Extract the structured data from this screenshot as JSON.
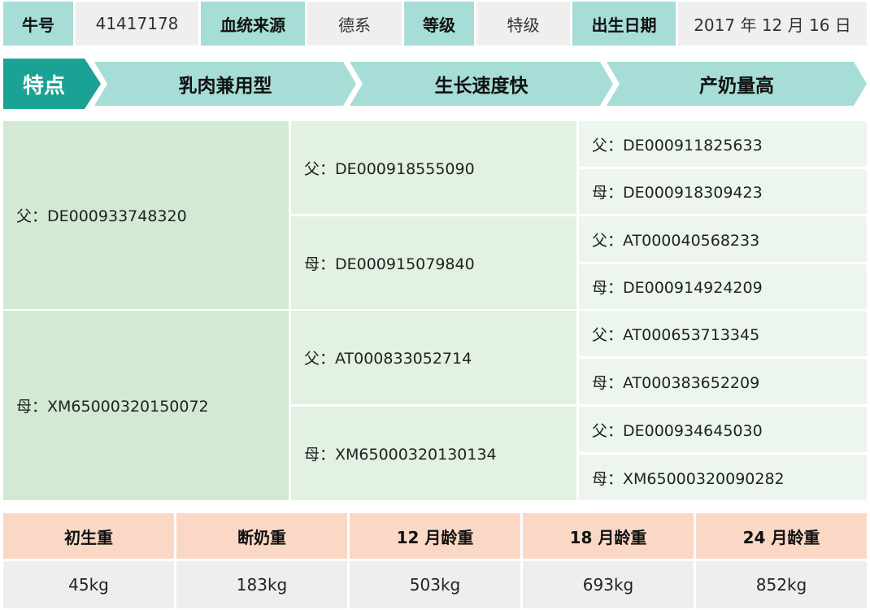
{
  "header": {
    "id_label": "牛号",
    "id_value": "41417178",
    "bloodline_label": "血统来源",
    "bloodline_value": "德系",
    "grade_label": "等级",
    "grade_value": "特级",
    "birth_label": "出生日期",
    "birth_value": "2017 年 12 月 16 日"
  },
  "traits": {
    "title": "特点",
    "items": [
      "乳肉兼用型",
      "生长速度快",
      "产奶量高"
    ]
  },
  "pedigree": {
    "sire": "父：DE000933748320",
    "dam": "母：XM65000320150072",
    "sire_sire": "父：DE000918555090",
    "sire_dam": "母：DE000915079840",
    "dam_sire": "父：AT000833052714",
    "dam_dam": "母：XM65000320130134",
    "ggp": [
      "父：DE000911825633",
      "母：DE000918309423",
      "父：AT000040568233",
      "母：DE000914924209",
      "父：AT000653713345",
      "母：AT000383652209",
      "父：DE000934645030",
      "母：XM65000320090282"
    ]
  },
  "weights": {
    "headers": [
      "初生重",
      "断奶重",
      "12 月龄重",
      "18 月龄重",
      "24 月龄重"
    ],
    "values": [
      "45kg",
      "183kg",
      "503kg",
      "693kg",
      "852kg"
    ]
  },
  "colors": {
    "header_label_bg": "#a6ddd6",
    "value_bg": "#efefef",
    "trait_head": "#1aa394",
    "trait_arrow": "#a6ddd6",
    "pedigree_g1": "#d2e9d3",
    "pedigree_g2": "#e2f1e2",
    "pedigree_g3": "#ecf6ec",
    "weight_header_bg": "#fbd8c6"
  }
}
